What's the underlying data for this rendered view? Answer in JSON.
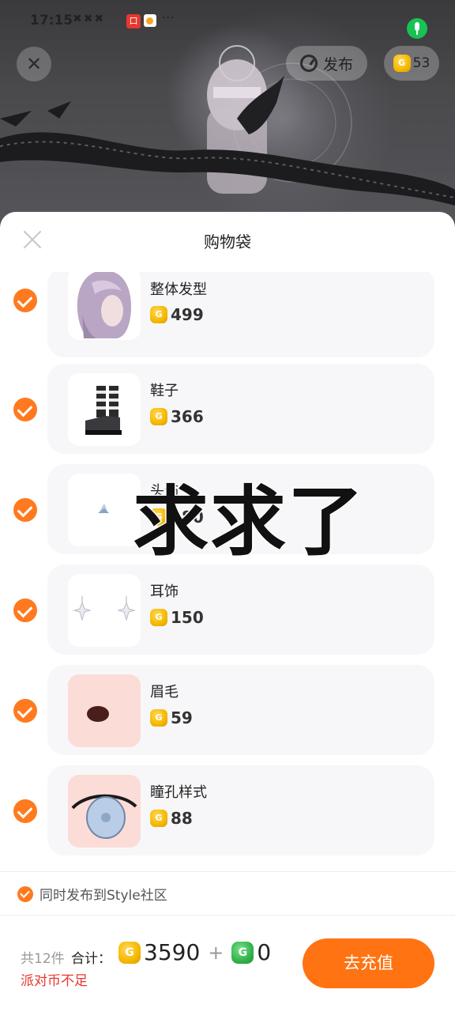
{
  "status_bar": {
    "time": "17:15",
    "notif_glyphs": "✖✖✖",
    "app_badge": "口",
    "more": "···"
  },
  "scene": {
    "close_glyph": "✕",
    "publish_label": "发布",
    "coin_balance": "53"
  },
  "sheet": {
    "title": "购物袋"
  },
  "items": [
    {
      "name": "整体发型",
      "price": "499",
      "thumb": "hair-thumbnail"
    },
    {
      "name": "鞋子",
      "price": "366",
      "thumb": "shoes-thumbnail"
    },
    {
      "name": "头饰",
      "price": "180",
      "thumb": "accessory-thumbnail"
    },
    {
      "name": "耳饰",
      "price": "150",
      "thumb": "earring-thumbnail"
    },
    {
      "name": "眉毛",
      "price": "59",
      "thumb": "eyebrow-thumbnail"
    },
    {
      "name": "瞳孔样式",
      "price": "88",
      "thumb": "pupil-thumbnail"
    }
  ],
  "overlay_caption": "求求了",
  "sync": {
    "label": "同时发布到Style社区",
    "checked": true
  },
  "footer": {
    "count_label": "共12件",
    "total_label": "合计：",
    "gold_amount": "3590",
    "plus": "+",
    "green_amount": "0",
    "warning": "派对币不足",
    "recharge_label": "去充值"
  },
  "colors": {
    "accent": "#ff7312",
    "check": "#ff7a1f",
    "warning": "#e8372f",
    "gold_coin": "#f5b800",
    "green_coin": "#34b24b"
  }
}
